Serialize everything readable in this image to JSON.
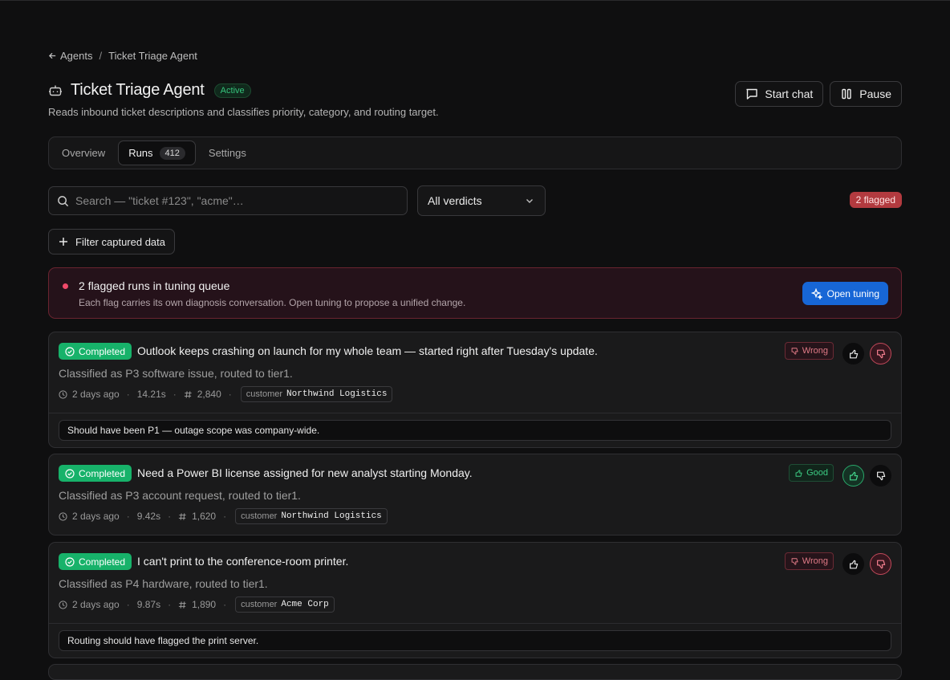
{
  "breadcrumb": {
    "back_label": "Agents",
    "separator": "/",
    "current": "Ticket Triage Agent"
  },
  "header": {
    "title": "Ticket Triage Agent",
    "status": "Active",
    "description": "Reads inbound ticket descriptions and classifies priority, category, and routing target.",
    "actions": {
      "start_chat": "Start chat",
      "pause": "Pause"
    }
  },
  "tabs": [
    {
      "label": "Overview"
    },
    {
      "label": "Runs",
      "count": "412"
    },
    {
      "label": "Settings"
    }
  ],
  "filters": {
    "search_placeholder": "Search — \"ticket #123\", \"acme\"…",
    "verdict_select": "All verdicts",
    "flagged_badge": "2 flagged",
    "filter_button": "Filter captured data"
  },
  "alert": {
    "title": "2 flagged runs in tuning queue",
    "subtitle": "Each flag carries its own diagnosis conversation. Open tuning to propose a unified change.",
    "button": "Open tuning"
  },
  "runs": [
    {
      "status": "Completed",
      "title": "Outlook keeps crashing on launch for my whole team — started right after Tuesday's update.",
      "classification": "Classified as P3 software issue, routed to tier1.",
      "time": "2 days ago",
      "duration": "14.21s",
      "tokens": "2,840",
      "chip_key": "customer",
      "chip_value": "Northwind Logistics",
      "verdict": "Wrong",
      "feedback": "Should have been P1 — outage scope was company-wide."
    },
    {
      "status": "Completed",
      "title": "Need a Power BI license assigned for new analyst starting Monday.",
      "classification": "Classified as P3 account request, routed to tier1.",
      "time": "2 days ago",
      "duration": "9.42s",
      "tokens": "1,620",
      "chip_key": "customer",
      "chip_value": "Northwind Logistics",
      "verdict": "Good"
    },
    {
      "status": "Completed",
      "title": "I can't print to the conference-room printer.",
      "classification": "Classified as P4 hardware, routed to tier1.",
      "time": "2 days ago",
      "duration": "9.87s",
      "tokens": "1,890",
      "chip_key": "customer",
      "chip_value": "Acme Corp",
      "verdict": "Wrong",
      "feedback": "Routing should have flagged the print server."
    }
  ],
  "colors": {
    "accent_blue": "#1766d6",
    "success_green": "#17b26a",
    "danger_red": "#b23a3f"
  }
}
